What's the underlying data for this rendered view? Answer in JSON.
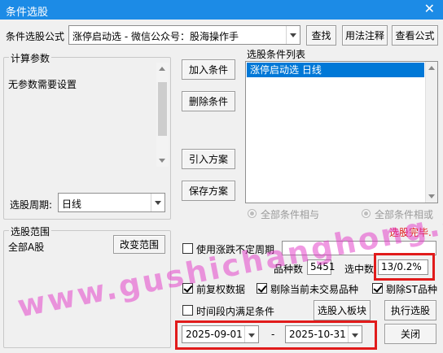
{
  "window": {
    "title": "条件选股",
    "close_glyph": "✕"
  },
  "formula": {
    "label": "条件选股公式",
    "value": "涨停启动选  -  微信公众号：股海操作手",
    "find_button": "查找",
    "usage_button": "用法注释",
    "view_button": "查看公式"
  },
  "params": {
    "group_title": "计算参数",
    "text": "无参数需要设置",
    "period_label": "选股周期:",
    "period_value": "日线"
  },
  "actions": {
    "add": "加入条件",
    "remove": "删除条件",
    "import": "引入方案",
    "save": "保存方案"
  },
  "conditions": {
    "label": "选股条件列表",
    "items": [
      "涨停启动选  日线"
    ],
    "logic_and": "全部条件相与",
    "logic_or": "全部条件相或"
  },
  "status": {
    "text": "选股完毕.",
    "color": "#e11b1b"
  },
  "range": {
    "group_title": "选股范围",
    "value": "全部A股",
    "change_button": "改变范围"
  },
  "options": {
    "variable_period": "使用涨跌不定周期",
    "count_label": "品种数",
    "count_value": "5451",
    "selected_label": "选中数",
    "selected_value": "13/0.2%",
    "forward_adjust": "前复权数据",
    "exclude_untraded": "剔除当前未交易品种",
    "exclude_st": "剔除ST品种",
    "time_range": "时间段内满足条件"
  },
  "bottom": {
    "to_block_button": "选股入板块",
    "execute_button": "执行选股",
    "close_button": "关闭",
    "start_date": "2025-09-01",
    "date_sep": "-",
    "end_date": "2025-10-31"
  },
  "watermark": "www.gushichanghong.com",
  "accent_colors": {
    "titlebar": "#1c8be6",
    "selection": "#0078d7",
    "highlight_box": "#e11b1b"
  }
}
